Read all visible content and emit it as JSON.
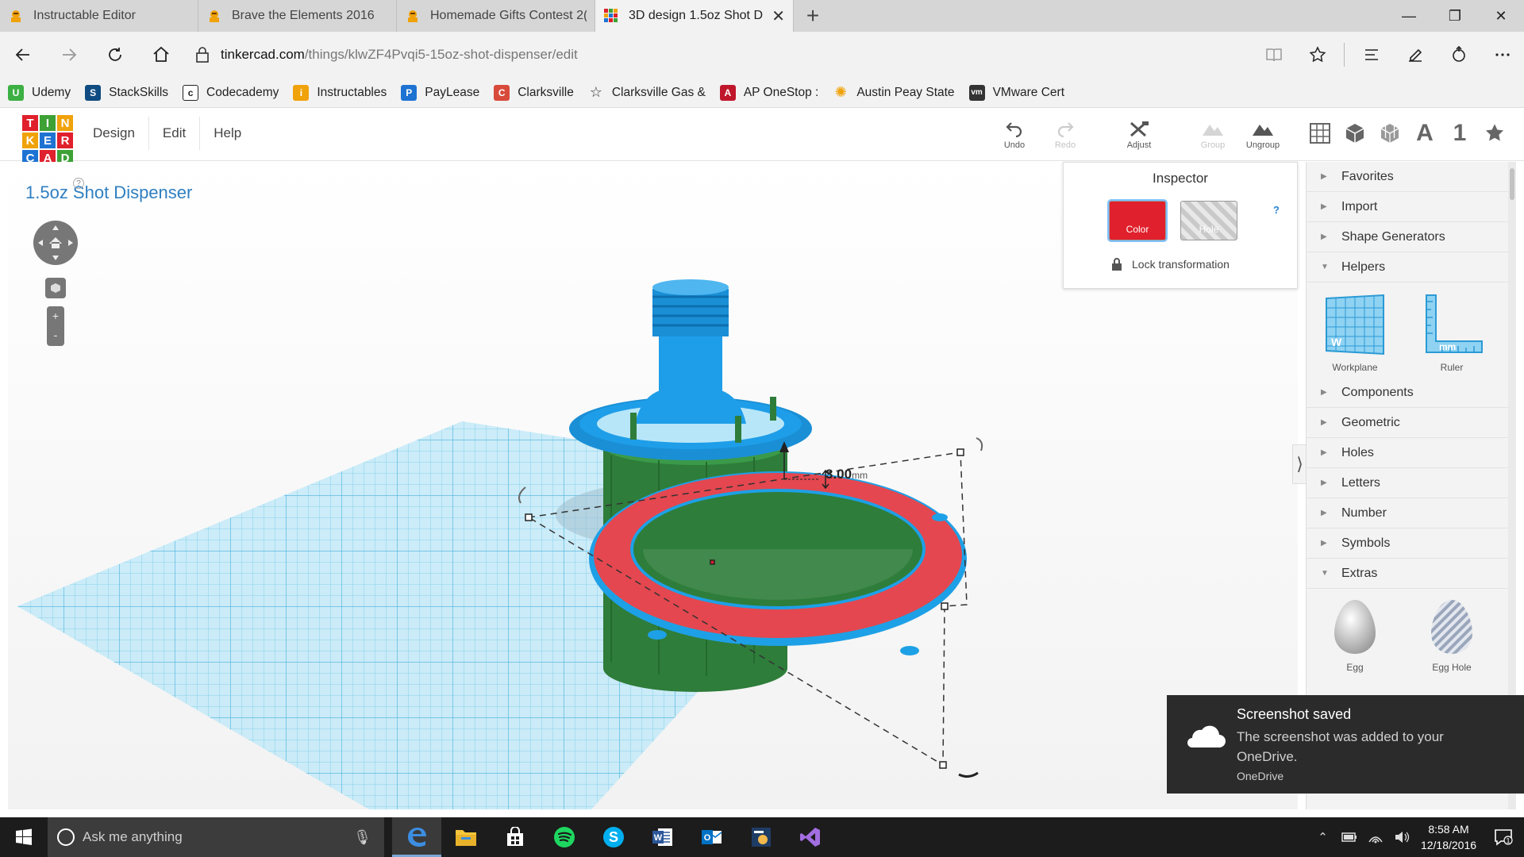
{
  "tabs": [
    {
      "title": "Instructable Editor",
      "icon": "instructables-icon"
    },
    {
      "title": "Brave the Elements 2016",
      "icon": "instructables-icon"
    },
    {
      "title": "Homemade Gifts Contest 2(",
      "icon": "instructables-icon"
    },
    {
      "title": "3D design 1.5oz Shot D",
      "icon": "tinkercad-icon",
      "active": true
    }
  ],
  "address": {
    "domain": "tinkercad.com",
    "path": "/things/klwZF4Pvqi5-15oz-shot-dispenser/edit"
  },
  "favorites": [
    {
      "label": "Udemy",
      "color": "#3cb043",
      "glyph": "U"
    },
    {
      "label": "StackSkills",
      "color": "#0f4c81",
      "glyph": "S"
    },
    {
      "label": "Codecademy",
      "color": "#ffffff",
      "glyph": "c"
    },
    {
      "label": "Instructables",
      "color": "#f0a20a",
      "glyph": "i"
    },
    {
      "label": "PayLease",
      "color": "#1e73d2",
      "glyph": "P"
    },
    {
      "label": "Clarksville",
      "color": "#d84a3a",
      "glyph": "C"
    },
    {
      "label": "Clarksville Gas &",
      "color": "#ffffff",
      "glyph": "☆"
    },
    {
      "label": "AP OneStop :",
      "color": "#c0162b",
      "glyph": "A"
    },
    {
      "label": "Austin Peay State",
      "color": "#f0a20a",
      "glyph": "✺"
    },
    {
      "label": "VMware Cert",
      "color": "#333333",
      "glyph": "vm"
    }
  ],
  "tinkercad": {
    "logo_letters": [
      "T",
      "I",
      "N",
      "K",
      "E",
      "R",
      "C",
      "A",
      "D"
    ],
    "menu": [
      "Design",
      "Edit",
      "Help"
    ],
    "tools": {
      "undo": "Undo",
      "redo": "Redo",
      "adjust": "Adjust",
      "group": "Group",
      "ungroup": "Ungroup"
    },
    "view_text_icon": "A",
    "view_number_icon": "1",
    "design_title": "1.5oz Shot Dispenser"
  },
  "viewport": {
    "dimension_value": "3.00",
    "dimension_unit": "mm",
    "nav_help": "?",
    "zoom_in": "+",
    "zoom_out": "-"
  },
  "inspector": {
    "title": "Inspector",
    "color_label": "Color",
    "hole_label": "Hole",
    "help": "?",
    "lock_label": "Lock transformation",
    "color_value": "#e0202c"
  },
  "sidepanel": {
    "categories_top": [
      {
        "label": "Favorites",
        "expanded": false
      },
      {
        "label": "Import",
        "expanded": false
      },
      {
        "label": "Shape Generators",
        "expanded": false
      },
      {
        "label": "Helpers",
        "expanded": true
      }
    ],
    "helpers": [
      {
        "label": "Workplane",
        "icon": "workplane-icon"
      },
      {
        "label": "Ruler",
        "icon": "ruler-icon"
      }
    ],
    "categories_mid": [
      {
        "label": "Components",
        "expanded": false
      },
      {
        "label": "Geometric",
        "expanded": false
      },
      {
        "label": "Holes",
        "expanded": false
      },
      {
        "label": "Letters",
        "expanded": false
      },
      {
        "label": "Number",
        "expanded": false
      },
      {
        "label": "Symbols",
        "expanded": false
      },
      {
        "label": "Extras",
        "expanded": true
      }
    ],
    "extras": [
      {
        "label": "Egg",
        "icon": "egg-icon"
      },
      {
        "label": "Egg Hole",
        "icon": "egg-hole-icon"
      }
    ]
  },
  "toast": {
    "title": "Screenshot saved",
    "body": "The screenshot was added to your OneDrive.",
    "source": "OneDrive"
  },
  "taskbar": {
    "search_placeholder": "Ask me anything",
    "time": "8:58 AM",
    "date": "12/18/2016",
    "notification_count": "1"
  }
}
